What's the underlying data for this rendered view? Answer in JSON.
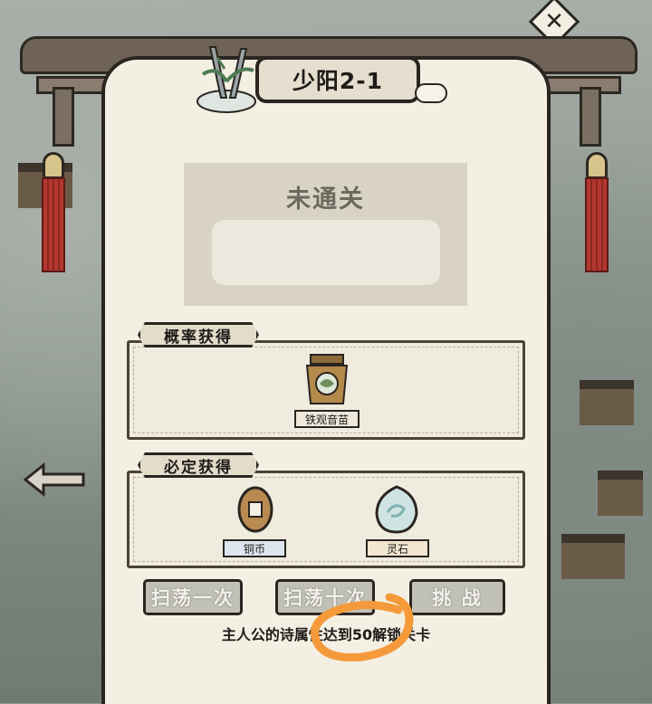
{
  "stage": {
    "title": "少阳2-1"
  },
  "status": {
    "text": "未通关"
  },
  "probability_rewards": {
    "header": "概率获得",
    "items": [
      {
        "name": "铁观音苗",
        "icon": "tea-pot-icon"
      }
    ]
  },
  "guaranteed_rewards": {
    "header": "必定获得",
    "items": [
      {
        "name": "铜币",
        "icon": "copper-coin-icon"
      },
      {
        "name": "灵石",
        "icon": "spirit-stone-icon"
      }
    ]
  },
  "buttons": {
    "sweep_once": "扫荡一次",
    "sweep_ten": "扫荡十次",
    "challenge": "挑 战"
  },
  "hint": {
    "text": "主人公的诗属性达到50解锁关卡"
  },
  "colors": {
    "panel": "#f4efe3",
    "border": "#2a2520",
    "tassel_red": "#b2372f",
    "annotation_orange": "#f59a3a",
    "button_disabled": "#c1c0b7"
  }
}
